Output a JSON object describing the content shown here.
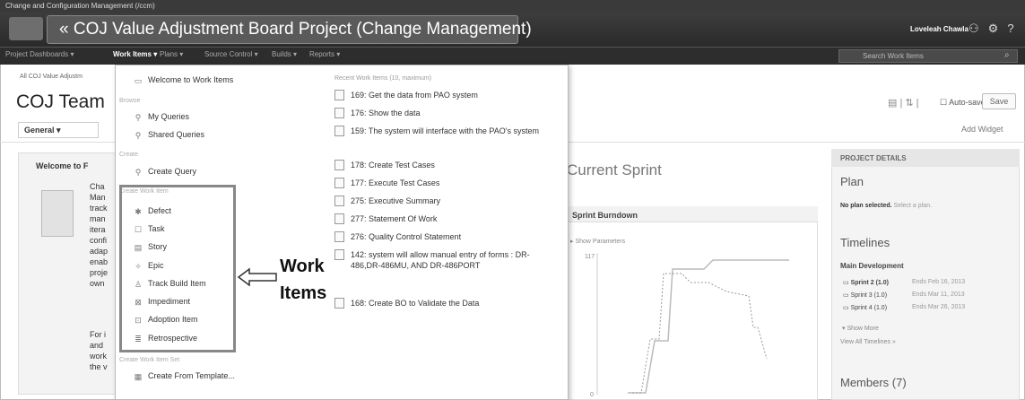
{
  "window": {
    "caption": "Change and Configuration Management (/ccm)"
  },
  "banner": {
    "title": "COJ Value Adjustment Board Project (Change Management)",
    "user": "Loveleah Chawla",
    "icons": [
      "user-icon",
      "gear-icon",
      "help-icon"
    ]
  },
  "menubar": {
    "items": [
      "Project Dashboards",
      "Work Items",
      "Plans",
      "Source Control",
      "Builds",
      "Reports"
    ],
    "active": "Work Items",
    "search_placeholder": "Search Work Items"
  },
  "page": {
    "breadcrumb": "All COJ Value Adjustm",
    "title": "COJ Team",
    "tab": "General",
    "autosave": "Auto-save",
    "save": "Save",
    "add_widget": "Add Widget"
  },
  "welcome": {
    "title": "Welcome to F",
    "text_lines": [
      "Cha",
      "Man",
      "track",
      "man",
      "itera",
      "confi",
      "adap",
      "enab",
      "proje",
      "own"
    ],
    "text_lines_2": [
      "For i",
      "and",
      "work",
      "the v"
    ]
  },
  "current_sprint": "Current Sprint",
  "burndown": {
    "title": "Sprint Burndown",
    "params": "Show Parameters",
    "y_top_label": "117",
    "y_bottom_label": "0"
  },
  "dropdown": {
    "welcome": "Welcome to Work Items",
    "browse_header": "Browse",
    "my_queries": "My Queries",
    "shared_queries": "Shared Queries",
    "create_header": "Create",
    "create_query": "Create Query",
    "create_work_item_header": "Create Work Item",
    "work_items": [
      "Defect",
      "Task",
      "Story",
      "Epic",
      "Track Build Item",
      "Impediment",
      "Adoption Item",
      "Retrospective"
    ],
    "create_set_header": "Create Work Item Set",
    "create_from_template": "Create From Template...",
    "recent_header": "Recent Work Items (10, maximum)",
    "recent": [
      "169: Get the data from PAO system",
      "176: Show the data",
      "159: The system will interface with the PAO's system",
      "178: Create Test Cases",
      "177: Execute Test Cases",
      "275: Executive Summary",
      "277: Statement Of Work",
      "276: Quality Control Statement",
      "142: system will allow manual entry of forms : DR-486,DR-486MU, AND DR-486PORT",
      "168: Create BO to Validate the Data"
    ]
  },
  "annotation": {
    "line1": "Work",
    "line2": "Items"
  },
  "project_details": {
    "header": "PROJECT DETAILS",
    "plan_heading": "Plan",
    "plan_note": "No plan selected.",
    "plan_link": "Select a plan.",
    "timelines_heading": "Timelines",
    "main_dev": "Main Development",
    "sprints": [
      {
        "name": "Sprint 2 (1.0)",
        "ends": "Ends Feb 16, 2013"
      },
      {
        "name": "Sprint 3 (1.0)",
        "ends": "Ends Mar 11, 2013"
      },
      {
        "name": "Sprint 4 (1.0)",
        "ends": "Ends Mar 26, 2013"
      }
    ],
    "show_more": "Show More",
    "view_all": "View All Timelines »",
    "members": "Members (7)"
  }
}
